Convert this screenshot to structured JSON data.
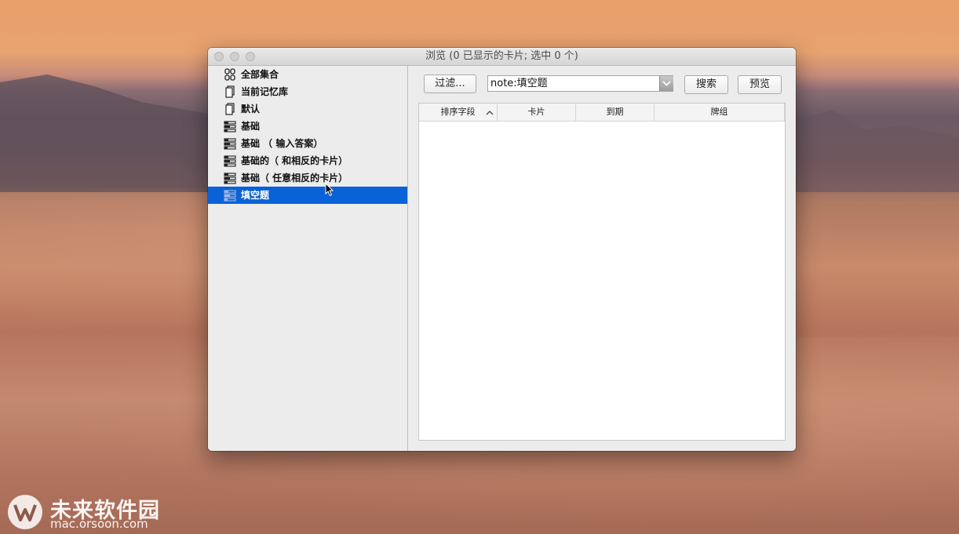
{
  "window": {
    "title": "浏览 (0 已显示的卡片; 选中 0 个)"
  },
  "sidebar": {
    "items": [
      {
        "label": "全部集合",
        "icon": "collection-icon",
        "selected": false
      },
      {
        "label": "当前记忆库",
        "icon": "deck-icon",
        "selected": false
      },
      {
        "label": "默认",
        "icon": "deck-icon",
        "selected": false
      },
      {
        "label": "基础",
        "icon": "note-type-icon",
        "selected": false
      },
      {
        "label": "基础 （ 输入答案）",
        "icon": "note-type-icon",
        "selected": false
      },
      {
        "label": "基础的（ 和相反的卡片）",
        "icon": "note-type-icon",
        "selected": false
      },
      {
        "label": "基础（ 任意相反的卡片）",
        "icon": "note-type-icon",
        "selected": false
      },
      {
        "label": "填空题",
        "icon": "note-type-icon",
        "selected": true
      }
    ]
  },
  "toolbar": {
    "filter_label": "过滤...",
    "search_value": "note:填空题",
    "search_button": "搜索",
    "preview_button": "预览"
  },
  "table": {
    "columns": [
      "排序字段",
      "卡片",
      "到期",
      "牌组"
    ],
    "sort_column": "排序字段",
    "sort_direction": "ascending",
    "rows": []
  },
  "watermark": {
    "brand": "未来软件园",
    "url": "mac.orsoon.com"
  },
  "colors": {
    "selection": "#0a62d8",
    "window_bg": "#ececec"
  }
}
